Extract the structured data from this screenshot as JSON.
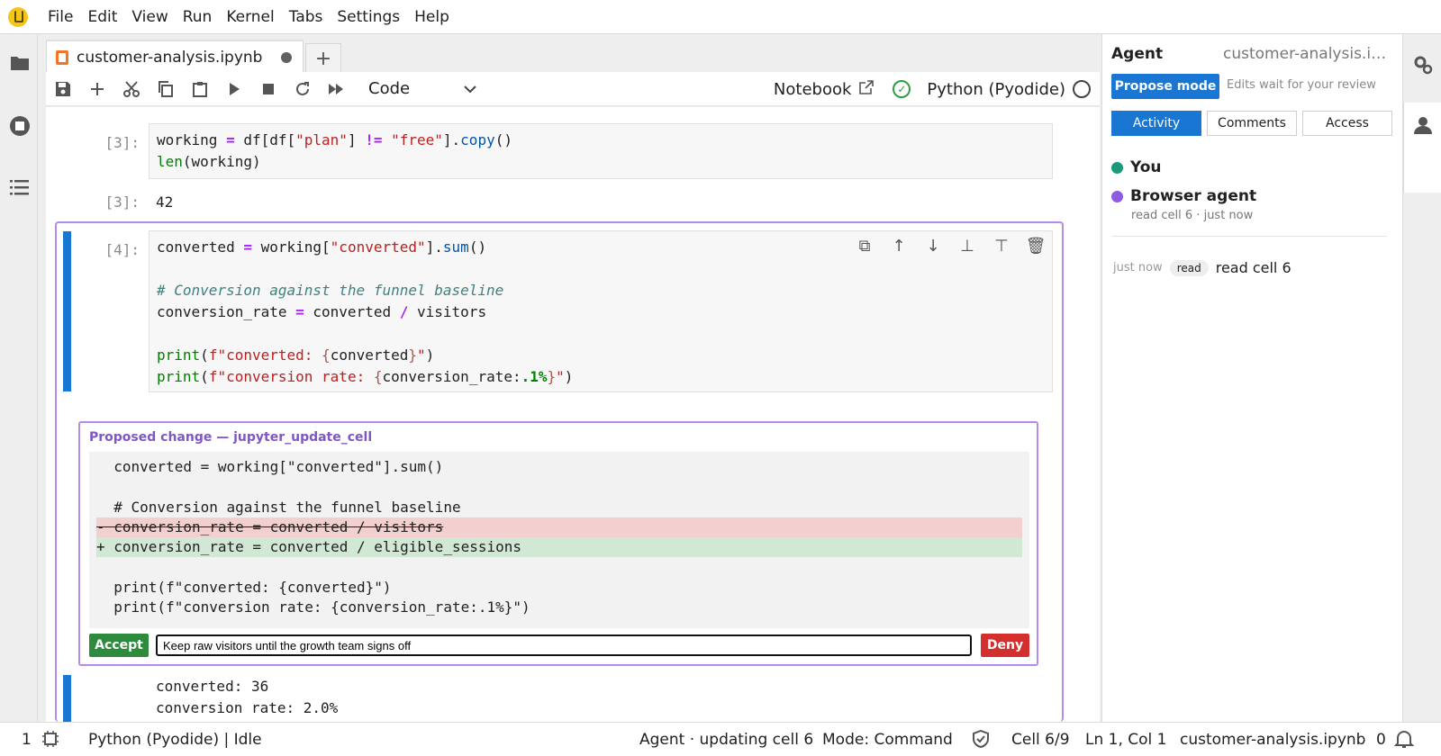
{
  "menu": [
    "File",
    "Edit",
    "View",
    "Run",
    "Kernel",
    "Tabs",
    "Settings",
    "Help"
  ],
  "tab": {
    "name": "customer-analysis.ipynb",
    "new_tab": "+"
  },
  "toolbar": {
    "cell_type": "Code",
    "notebook_label": "Notebook",
    "kernel_name": "Python (Pyodide)"
  },
  "cells": {
    "cell3": {
      "prompt_in": "[3]:",
      "prompt_out": "[3]:",
      "output": "42"
    },
    "cell4": {
      "prompt_in": "[4]:"
    }
  },
  "proposal": {
    "title": "Proposed change — jupyter_update_cell",
    "lines": [
      "  converted = working[\"converted\"].sum()",
      "",
      "  # Conversion against the funnel baseline",
      "- conversion_rate = converted / visitors",
      "+ conversion_rate = converted / eligible_sessions",
      "",
      "  print(f\"converted: {converted}\")",
      "  print(f\"conversion rate: {conversion_rate:.1%}\")"
    ],
    "accept_label": "Accept",
    "deny_label": "Deny",
    "comment_value": "Keep raw visitors until the growth team signs off"
  },
  "output4": {
    "line1": "converted: 36",
    "line2": "conversion rate: 2.0%"
  },
  "agent_panel": {
    "title": "Agent",
    "file": "customer-analysis.ipynb",
    "mode_button": "Propose mode",
    "mode_note": "Edits wait for your review",
    "tabs": [
      "Activity",
      "Comments",
      "Access"
    ],
    "participants": [
      {
        "name": "You",
        "color": "#1a9a7a"
      },
      {
        "name": "Browser agent",
        "color": "#8e5ce0",
        "sub": "read cell 6 · just now"
      }
    ],
    "activity": {
      "time": "just now",
      "tag": "read",
      "text": "read cell 6"
    }
  },
  "status": {
    "num": "1",
    "kernel": "Python (Pyodide) | Idle",
    "agent": "Agent · updating cell 6",
    "mode": "Mode: Command",
    "cell": "Cell 6/9",
    "pos": "Ln 1, Col 1",
    "file": "customer-analysis.ipynb",
    "notifications": "0"
  }
}
